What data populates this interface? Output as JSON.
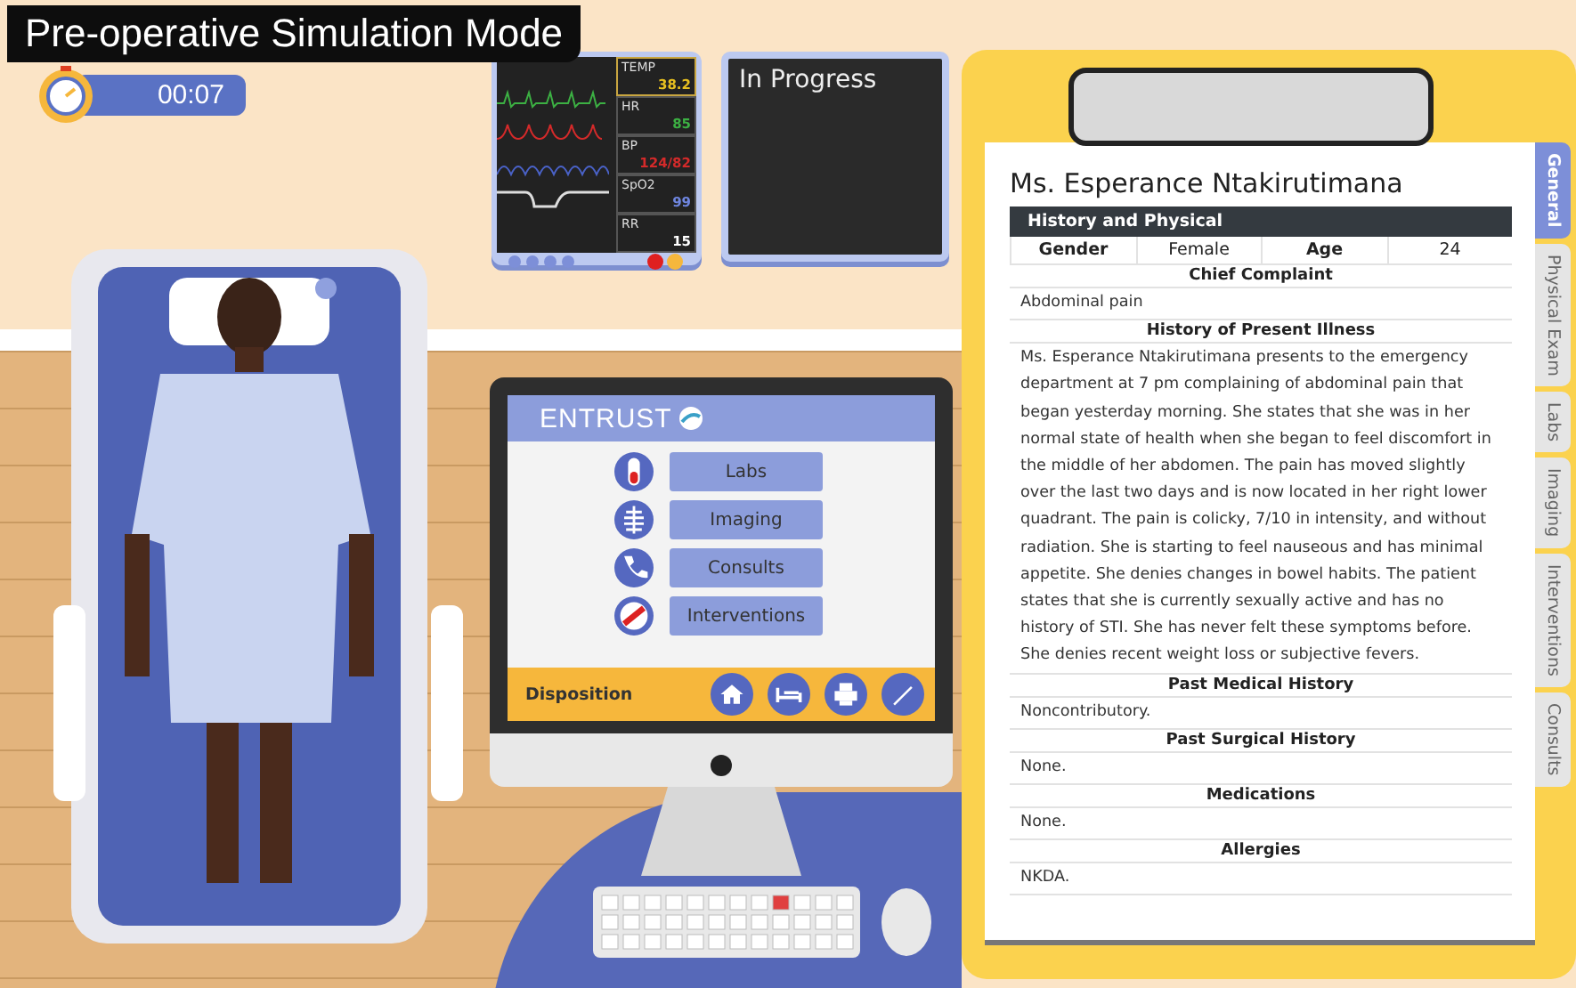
{
  "title": "Pre-operative Simulation Mode",
  "timer": {
    "time": "00:07"
  },
  "vitals_monitor": {
    "vitals": [
      {
        "label": "TEMP",
        "value": "38.2",
        "color": "#e8c020",
        "selected": true
      },
      {
        "label": "HR",
        "value": "85",
        "color": "#3cb043",
        "selected": false
      },
      {
        "label": "BP",
        "value": "124/82",
        "color": "#d42a2a",
        "selected": false
      },
      {
        "label": "SpO2",
        "value": "99",
        "color": "#6f86e0",
        "selected": false
      },
      {
        "label": "RR",
        "value": "15",
        "color": "#ffffff",
        "selected": false
      }
    ]
  },
  "status_panel": {
    "text": "In Progress"
  },
  "computer": {
    "logo": "ENTRUST",
    "menu": [
      {
        "label": "Labs"
      },
      {
        "label": "Imaging"
      },
      {
        "label": "Consults"
      },
      {
        "label": "Interventions"
      }
    ],
    "footer": {
      "label": "Disposition"
    }
  },
  "clipboard": {
    "patient_name": "Ms. Esperance Ntakirutimana",
    "section_title": "History and Physical",
    "demographics": [
      {
        "label": "Gender",
        "value": "Female"
      },
      {
        "label": "Age",
        "value": "24"
      }
    ],
    "sections": [
      {
        "heading": "Chief Complaint",
        "text": "Abdominal pain"
      },
      {
        "heading": "History of Present Illness",
        "text": "Ms. Esperance Ntakirutimana presents to the emergency department at 7 pm complaining of abdominal pain that began yesterday morning. She states that she was in her normal state of health when she began to feel discomfort in the middle of her abdomen. The pain has moved slightly over the last two days and is now located in her right lower quadrant. The pain is colicky, 7/10 in intensity, and without radiation. She is starting to feel nauseous and has minimal appetite. She denies changes in bowel habits. The patient states that she is currently sexually active and has no history of STI. She has never felt these symptoms before. She denies recent weight loss or subjective fevers."
      },
      {
        "heading": "Past Medical History",
        "text": "Noncontributory."
      },
      {
        "heading": "Past Surgical History",
        "text": "None."
      },
      {
        "heading": "Medications",
        "text": "None."
      },
      {
        "heading": "Allergies",
        "text": "NKDA."
      }
    ],
    "tabs": [
      {
        "label": "General",
        "selected": true
      },
      {
        "label": "Physical Exam",
        "selected": false
      },
      {
        "label": "Labs",
        "selected": false
      },
      {
        "label": "Imaging",
        "selected": false
      },
      {
        "label": "Interventions",
        "selected": false
      },
      {
        "label": "Consults",
        "selected": false
      }
    ]
  }
}
